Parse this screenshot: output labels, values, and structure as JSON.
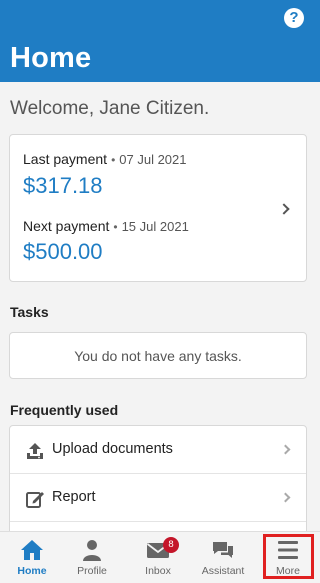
{
  "header": {
    "title": "Home",
    "help_icon": "?"
  },
  "welcome": "Welcome, Jane Citizen.",
  "payments": {
    "last_label": "Last payment",
    "last_date": "07 Jul 2021",
    "last_amount": "$317.18",
    "next_label": "Next payment",
    "next_date": "15 Jul 2021",
    "next_amount": "$500.00",
    "separator": "•"
  },
  "tasks": {
    "title": "Tasks",
    "empty_message": "You do not have any tasks."
  },
  "frequently_used": {
    "title": "Frequently used",
    "items": [
      {
        "label": "Upload documents",
        "icon": "upload-icon"
      },
      {
        "label": "Report",
        "icon": "edit-icon"
      }
    ]
  },
  "tabbar": {
    "tabs": [
      {
        "label": "Home",
        "icon": "home-icon",
        "active": true
      },
      {
        "label": "Profile",
        "icon": "person-icon"
      },
      {
        "label": "Inbox",
        "icon": "envelope-icon",
        "badge": "8"
      },
      {
        "label": "Assistant",
        "icon": "chat-icon"
      },
      {
        "label": "More",
        "icon": "menu-icon"
      }
    ]
  },
  "colors": {
    "brand": "#1f7dc4",
    "badge": "#c4162a",
    "highlight": "#e02020"
  }
}
